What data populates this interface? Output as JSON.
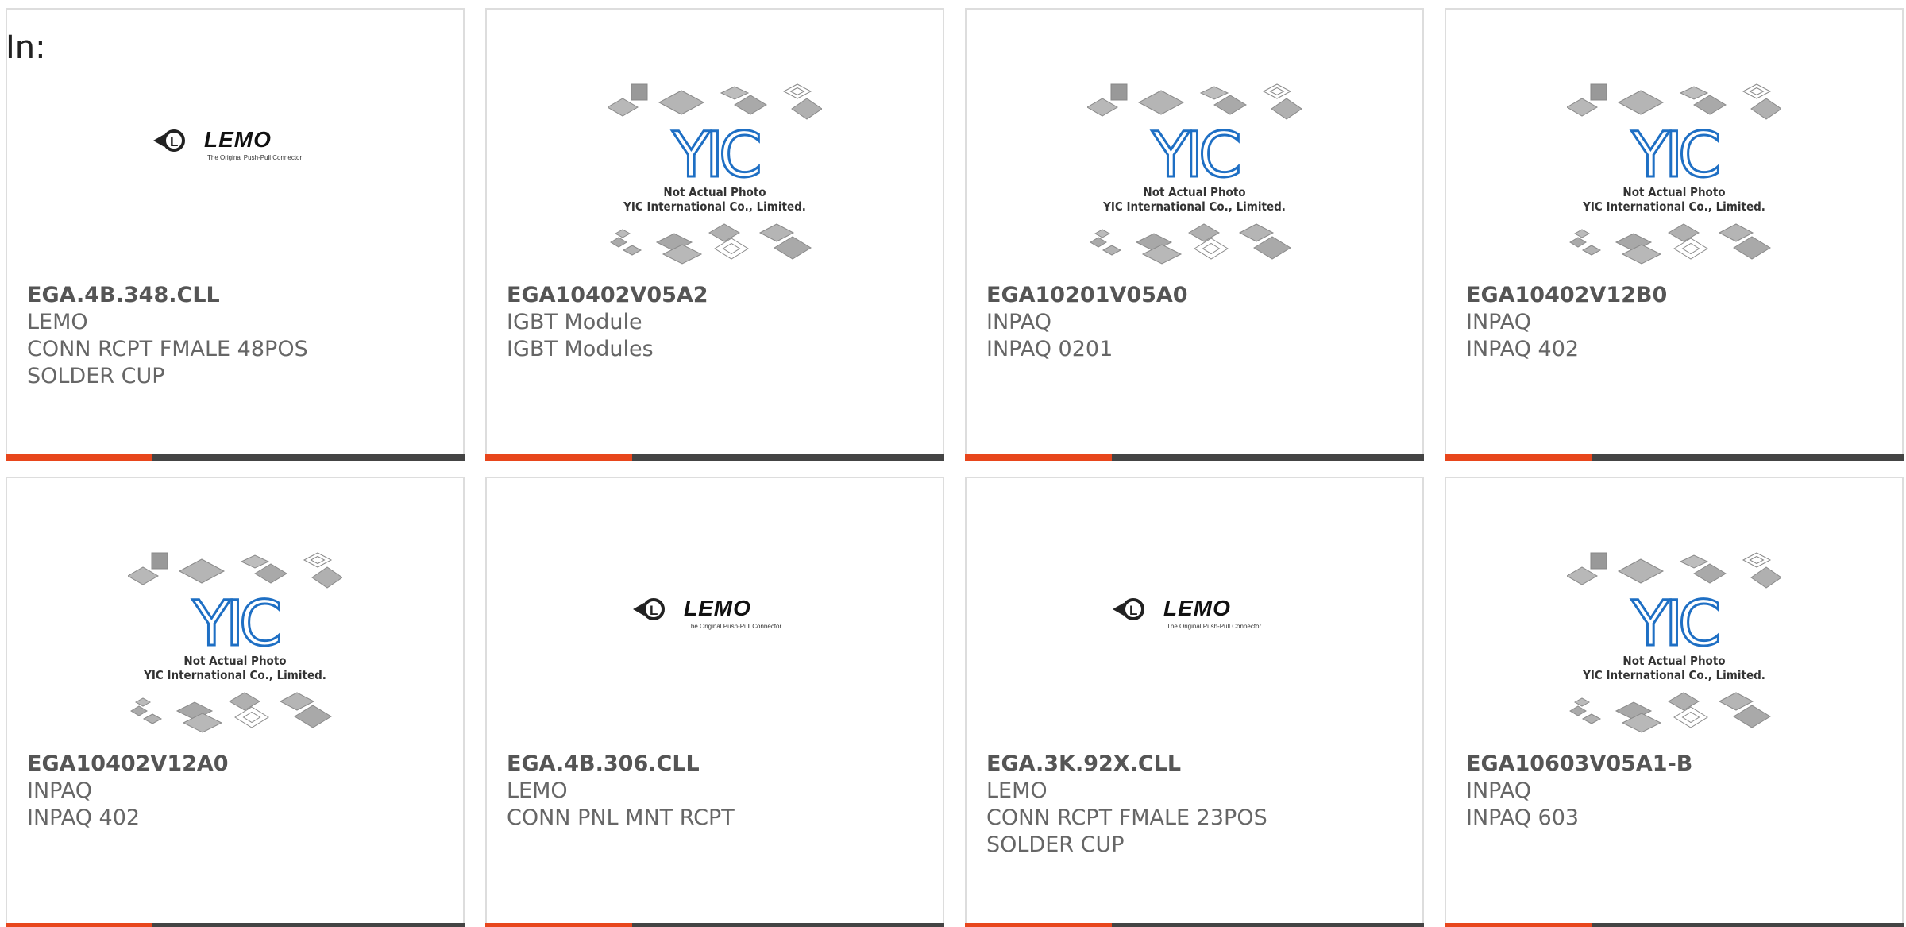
{
  "header": {
    "label": "In:"
  },
  "brand_colors": {
    "accent": "#e8461c",
    "bar": "#444444",
    "yic_blue": "#1e6fc4"
  },
  "products": [
    {
      "part": "EGA.4B.348.CLL",
      "lines": [
        "LEMO",
        "CONN RCPT FMALE 48POS",
        "SOLDER CUP"
      ],
      "image": "lemo",
      "logo_text": "LEMO",
      "logo_tagline": "The Original Push-Pull Connector"
    },
    {
      "part": "EGA10402V05A2",
      "lines": [
        "IGBT Module",
        "IGBT Modules"
      ],
      "image": "yic",
      "logo_text": "YIC",
      "caption1": "Not Actual Photo",
      "caption2": "YIC International Co., Limited."
    },
    {
      "part": "EGA10201V05A0",
      "lines": [
        "INPAQ",
        "INPAQ 0201"
      ],
      "image": "yic",
      "logo_text": "YIC",
      "caption1": "Not Actual Photo",
      "caption2": "YIC International Co., Limited."
    },
    {
      "part": "EGA10402V12B0",
      "lines": [
        "INPAQ",
        "INPAQ 402"
      ],
      "image": "yic",
      "logo_text": "YIC",
      "caption1": "Not Actual Photo",
      "caption2": "YIC International Co., Limited."
    },
    {
      "part": "EGA10402V12A0",
      "lines": [
        "INPAQ",
        "INPAQ 402"
      ],
      "image": "yic",
      "logo_text": "YIC",
      "caption1": "Not Actual Photo",
      "caption2": "YIC International Co., Limited."
    },
    {
      "part": "EGA.4B.306.CLL",
      "lines": [
        "LEMO",
        "CONN PNL MNT RCPT"
      ],
      "image": "lemo",
      "logo_text": "LEMO",
      "logo_tagline": "The Original Push-Pull Connector"
    },
    {
      "part": "EGA.3K.92X.CLL",
      "lines": [
        "LEMO",
        "CONN RCPT FMALE 23POS",
        "SOLDER CUP"
      ],
      "image": "lemo",
      "logo_text": "LEMO",
      "logo_tagline": "The Original Push-Pull Connector"
    },
    {
      "part": "EGA10603V05A1-B",
      "lines": [
        "INPAQ",
        "INPAQ 603"
      ],
      "image": "yic",
      "logo_text": "YIC",
      "caption1": "Not Actual Photo",
      "caption2": "YIC International Co., Limited."
    }
  ]
}
